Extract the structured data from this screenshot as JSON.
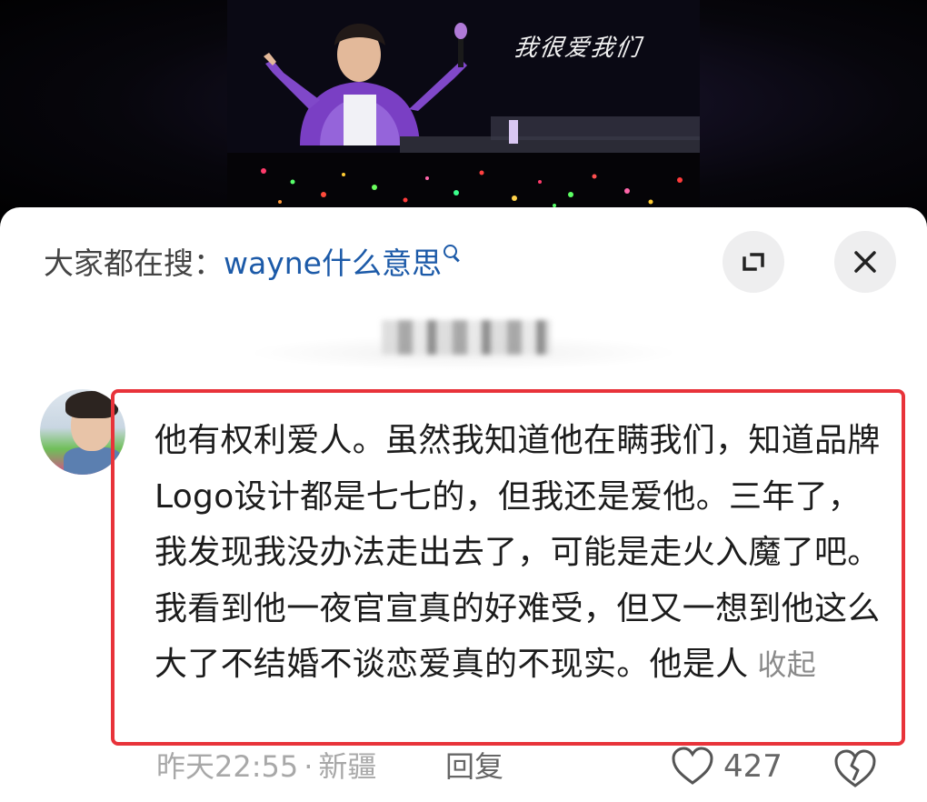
{
  "video": {
    "caption": "我很爱我们"
  },
  "search_suggestion": {
    "prefix": "大家都在搜：",
    "query": "wayne什么意思",
    "icon": "search-icon"
  },
  "controls": {
    "expand_icon": "expand-icon",
    "close_icon": "close-icon"
  },
  "comment": {
    "text": "他有权利爱人。虽然我知道他在瞒我们，知道品牌Logo设计都是七七的，但我还是爱他。三年了，我发现我没办法走出去了，可能是走火入魔了吧。我看到他一夜官宣真的好难受，但又一想到他这么大了不结婚不谈恋爱真的不现实。他是人",
    "collapse_label": "收起",
    "time": "昨天22:55",
    "separator": "·",
    "location": "新疆",
    "reply_label": "回复",
    "like_count": "427"
  },
  "colors": {
    "link_blue": "#1c5aa8",
    "highlight_red": "#e8333a",
    "meta_gray": "#a8a8a8"
  }
}
